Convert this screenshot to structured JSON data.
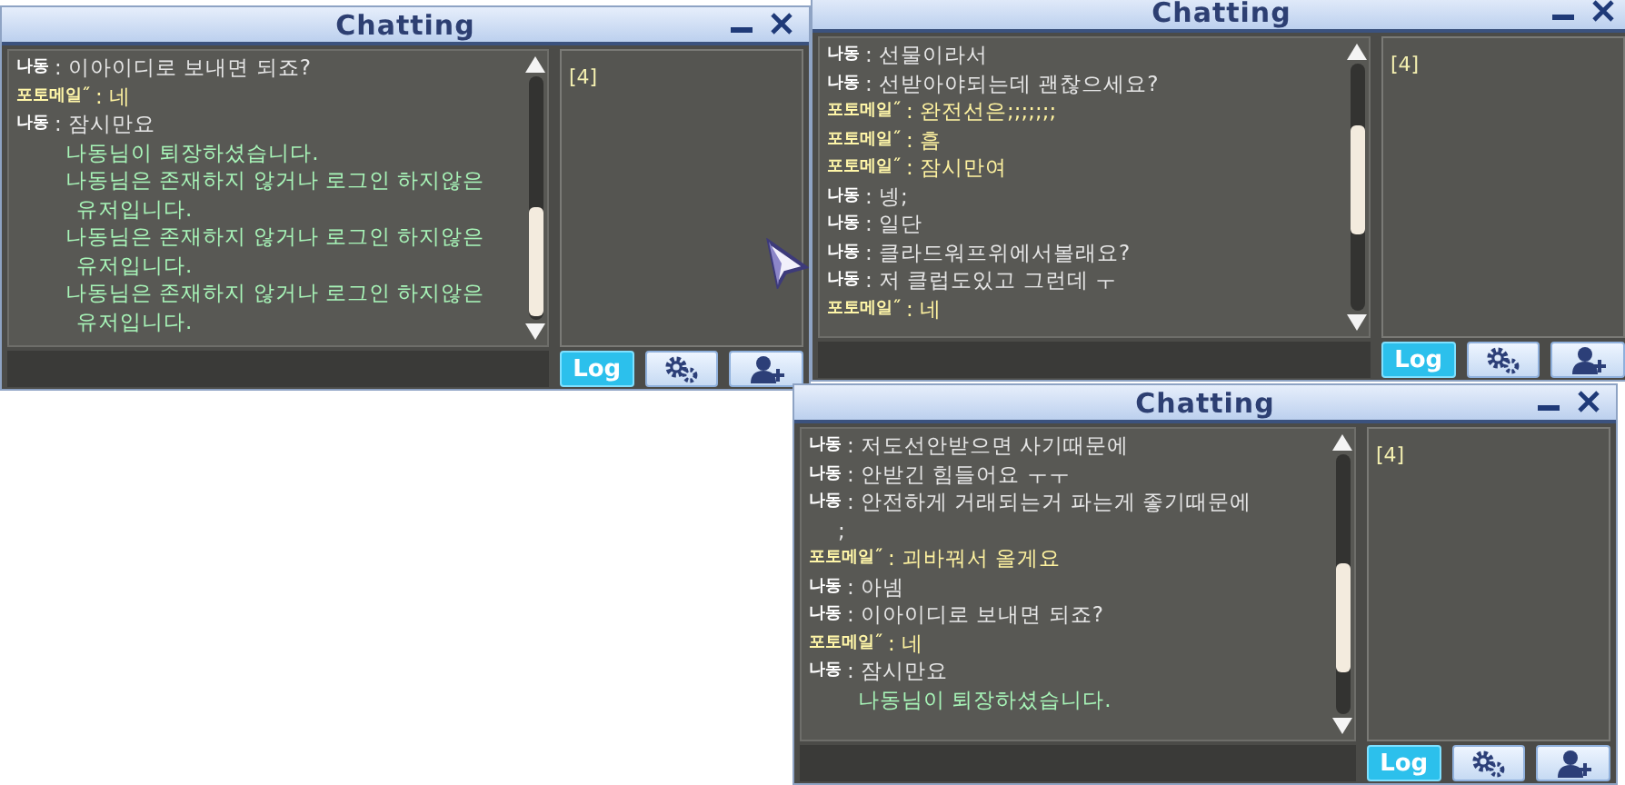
{
  "windows": [
    {
      "title": "Chatting",
      "channel": "[4]",
      "messages": [
        {
          "kind": "self",
          "speaker": "나동",
          "text": ": 이아이디로 보내면 되죠?"
        },
        {
          "kind": "partner",
          "speaker": "포토메일˝",
          "text": ": 네"
        },
        {
          "kind": "self",
          "speaker": "나동",
          "text": ": 잠시만요"
        },
        {
          "kind": "system",
          "text": "나동님이 퇴장하셨습니다."
        },
        {
          "kind": "system",
          "text": "나동님은 존재하지 않거나 로그인 하지않은\n유저입니다."
        },
        {
          "kind": "system",
          "text": "나동님은 존재하지 않거나 로그인 하지않은\n유저입니다."
        },
        {
          "kind": "system",
          "text": "나동님은 존재하지 않거나 로그인 하지않은\n유저입니다."
        }
      ],
      "buttons": [
        {
          "kind": "log",
          "label": "Log",
          "selected": true
        },
        {
          "kind": "settings",
          "selected": false
        },
        {
          "kind": "add_friend",
          "selected": false
        }
      ]
    },
    {
      "title": "Chatting",
      "channel": "[4]",
      "messages": [
        {
          "kind": "self",
          "speaker": "나동",
          "text": ": 선물이라서"
        },
        {
          "kind": "self",
          "speaker": "나동",
          "text": ": 선받아야되는데 괜찮으세요?"
        },
        {
          "kind": "partner",
          "speaker": "포토메일˝",
          "text": ": 완전선은;;;;;;;"
        },
        {
          "kind": "partner",
          "speaker": "포토메일˝",
          "text": ": 흠"
        },
        {
          "kind": "partner",
          "speaker": "포토메일˝",
          "text": ": 잠시만여"
        },
        {
          "kind": "self",
          "speaker": "나동",
          "text": ": 넹;"
        },
        {
          "kind": "self",
          "speaker": "나동",
          "text": ": 일단"
        },
        {
          "kind": "self",
          "speaker": "나동",
          "text": ": 클라드워프위에서볼래요?"
        },
        {
          "kind": "self",
          "speaker": "나동",
          "text": ": 저 클럽도있고 그런데 ㅜ"
        },
        {
          "kind": "partner",
          "speaker": "포토메일˝",
          "text": ": 네"
        }
      ],
      "buttons": [
        {
          "kind": "log",
          "label": "Log",
          "selected": true
        },
        {
          "kind": "settings",
          "selected": false
        },
        {
          "kind": "add_friend",
          "selected": false
        }
      ]
    },
    {
      "title": "Chatting",
      "channel": "[4]",
      "messages": [
        {
          "kind": "self",
          "speaker": "나동",
          "text": ": 저도선안받으면 사기때문에"
        },
        {
          "kind": "self",
          "speaker": "나동",
          "text": ": 안받긴 힘들어요 ㅜㅜ"
        },
        {
          "kind": "self",
          "speaker": "나동",
          "text": ": 안전하게 거래되는거 파는게 좋기때문에\n;"
        },
        {
          "kind": "partner",
          "speaker": "포토메일˝",
          "text": ": 괴바꿔서 올게요"
        },
        {
          "kind": "self",
          "speaker": "나동",
          "text": ": 아넴"
        },
        {
          "kind": "self",
          "speaker": "나동",
          "text": ": 이아이디로 보내면 되죠?"
        },
        {
          "kind": "partner",
          "speaker": "포토메일˝",
          "text": ": 네"
        },
        {
          "kind": "self",
          "speaker": "나동",
          "text": ": 잠시만요"
        },
        {
          "kind": "system",
          "text": "나동님이 퇴장하셨습니다."
        }
      ],
      "buttons": [
        {
          "kind": "log",
          "label": "Log",
          "selected": true
        },
        {
          "kind": "settings",
          "selected": false
        },
        {
          "kind": "add_friend",
          "selected": false
        }
      ]
    }
  ]
}
